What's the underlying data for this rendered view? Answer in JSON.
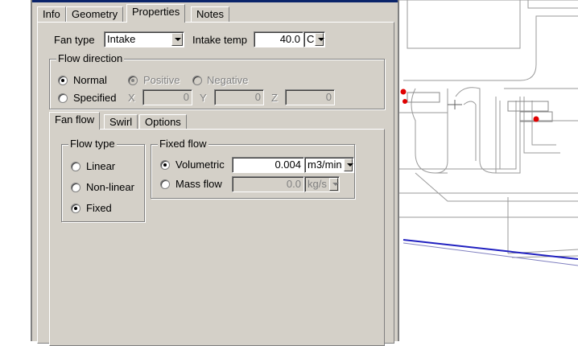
{
  "top_tabs": [
    {
      "label": "Info"
    },
    {
      "label": "Geometry"
    },
    {
      "label": "Properties",
      "active": true
    },
    {
      "label": "Notes"
    }
  ],
  "fan_type": {
    "label": "Fan type",
    "value": "Intake"
  },
  "intake_temp": {
    "label": "Intake temp",
    "value": "40.0",
    "unit": "C"
  },
  "flow_direction": {
    "title": "Flow direction",
    "normal_label": "Normal",
    "positive_label": "Positive",
    "negative_label": "Negative",
    "specified_label": "Specified",
    "x_label": "X",
    "x_value": "0",
    "y_label": "Y",
    "y_value": "0",
    "z_label": "Z",
    "z_value": "0"
  },
  "sub_tabs": [
    {
      "label": "Fan flow",
      "active": true
    },
    {
      "label": "Swirl"
    },
    {
      "label": "Options"
    }
  ],
  "flow_type": {
    "title": "Flow type",
    "options": [
      "Linear",
      "Non-linear",
      "Fixed"
    ],
    "selected": "Fixed"
  },
  "fixed_flow": {
    "title": "Fixed flow",
    "volumetric_label": "Volumetric",
    "volumetric_value": "0.004",
    "volumetric_unit": "m3/min",
    "mass_label": "Mass flow",
    "mass_value": "0.0",
    "mass_unit": "kg/s"
  },
  "colors": {
    "dialog_bg": "#d4d0c8",
    "viewport_bg": "#ffffff",
    "model_lines": "#9a9a9a",
    "marker_red": "#e00000",
    "floor_blue": "#2020c0"
  }
}
